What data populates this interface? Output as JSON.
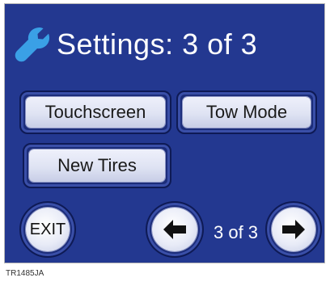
{
  "header": {
    "title": "Settings: 3 of 3",
    "icon": "wrench-icon"
  },
  "buttons": {
    "touchscreen": "Touchscreen",
    "tow_mode": "Tow Mode",
    "new_tires": "New Tires"
  },
  "footer": {
    "exit_label": "EXIT",
    "prev_icon": "arrow-left-icon",
    "next_icon": "arrow-right-icon",
    "page_indicator": "3 of 3"
  },
  "caption": "TR1485JA",
  "colors": {
    "background": "#233890",
    "accent_icon": "#3aa0e6",
    "button_face": "#dfe3f3",
    "text_light": "#ffffff"
  }
}
